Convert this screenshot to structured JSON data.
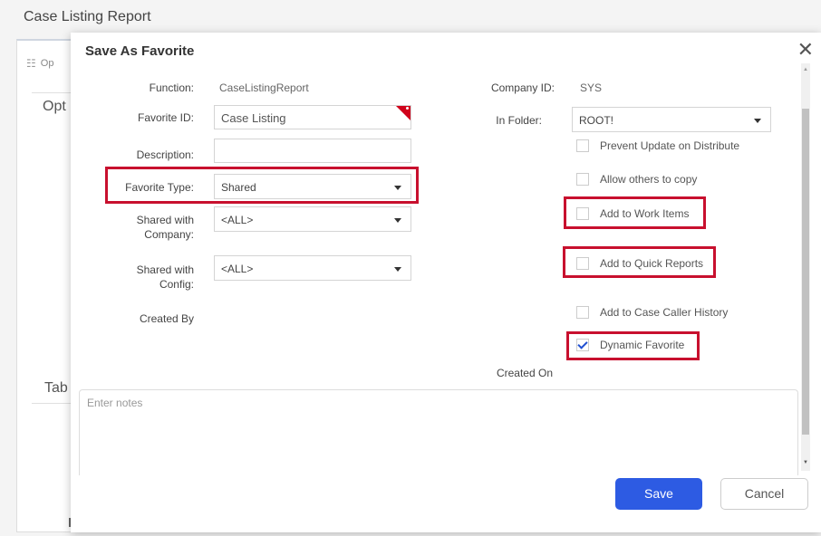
{
  "page": {
    "title": "Case Listing Report"
  },
  "background": {
    "tab_label": "Op",
    "opt_label": "Opt",
    "tab2_label": "Tab"
  },
  "dialog": {
    "title": "Save As Favorite",
    "close_glyph": "✕",
    "left": {
      "function_label": "Function:",
      "function_value": "CaseListingReport",
      "favorite_id_label": "Favorite ID:",
      "favorite_id_value": "Case Listing",
      "description_label": "Description:",
      "description_value": "",
      "favorite_type_label": "Favorite Type:",
      "favorite_type_value": "Shared",
      "shared_company_label_1": "Shared with",
      "shared_company_label_2": "Company:",
      "shared_company_value": "<ALL>",
      "shared_config_label_1": "Shared with",
      "shared_config_label_2": "Config:",
      "shared_config_value": "<ALL>",
      "created_by_label": "Created By"
    },
    "right": {
      "company_id_label": "Company ID:",
      "company_id_value": "SYS",
      "in_folder_label": "In Folder:",
      "in_folder_value": "ROOT!",
      "created_on_label": "Created On",
      "checkboxes": [
        {
          "label": "Prevent Update on Distribute",
          "checked": false
        },
        {
          "label": "Allow others to copy",
          "checked": false
        },
        {
          "label": "Add to Work Items",
          "checked": false
        },
        {
          "label": "Add to Quick Reports",
          "checked": false
        },
        {
          "label": "Add to Case Caller History",
          "checked": false
        },
        {
          "label": "Dynamic Favorite",
          "checked": true
        }
      ]
    },
    "notes_placeholder": "Enter notes",
    "save_label": "Save",
    "cancel_label": "Cancel"
  },
  "colors": {
    "highlight": "#c8102e",
    "primary": "#2d5be3",
    "check": "#1f4fd1"
  },
  "icons": {
    "tab_icon": "list-icon",
    "close": "close-icon",
    "select_caret": "chevron-down-icon"
  }
}
